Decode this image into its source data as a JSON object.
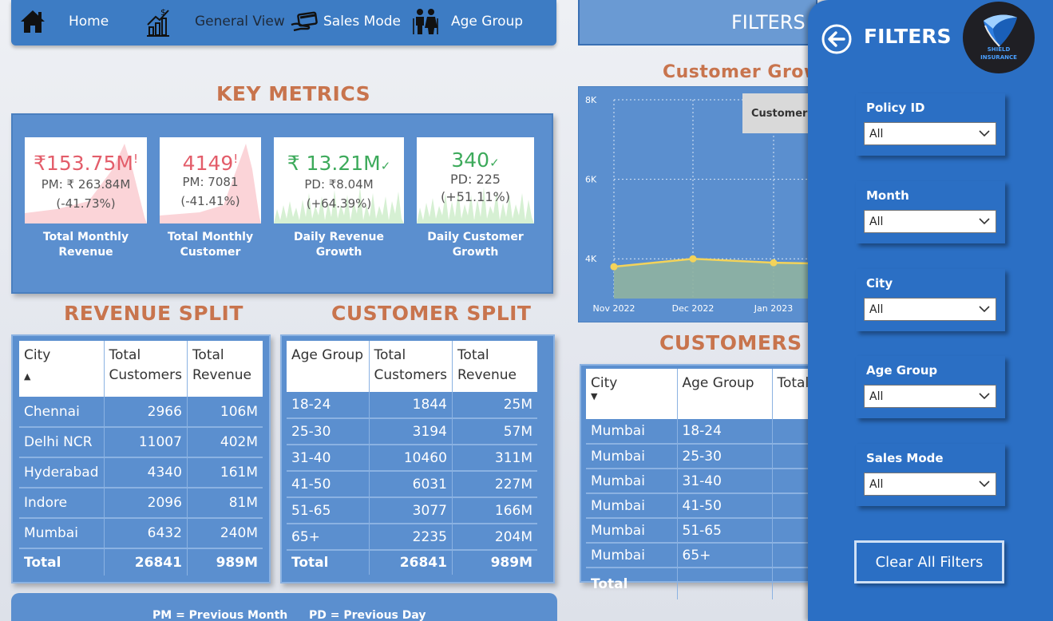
{
  "nav": {
    "home": "Home",
    "general_view": "General View",
    "sales_mode": "Sales Mode",
    "age_group": "Age Group",
    "filters_tab": "FILTERS"
  },
  "key_metrics": {
    "title": "KEY METRICS",
    "cards": [
      {
        "value": "₹153.75M",
        "flag": "!",
        "sub": "PM: ₹ 263.84M",
        "pct": "(-41.73%)",
        "caption_line1": "Total Monthly",
        "caption_line2": "Revenue",
        "status": "down"
      },
      {
        "value": "4149",
        "flag": "!",
        "sub": "PM: 7081",
        "pct": "(-41.41%)",
        "caption_line1": "Total Monthly",
        "caption_line2": "Customer",
        "status": "down"
      },
      {
        "value": "₹ 13.21M",
        "flag": "✓",
        "sub": "PD: ₹8.04M",
        "pct": "(+64.39%)",
        "caption_line1": "Daily Revenue",
        "caption_line2": "Growth",
        "status": "up"
      },
      {
        "value": "340",
        "flag": "✓",
        "sub": "PD: 225",
        "pct": "(+51.11%)",
        "caption_line1": "Daily Customer",
        "caption_line2": "Growth",
        "status": "up"
      }
    ]
  },
  "revenue_split": {
    "title": "REVENUE SPLIT",
    "headers": [
      "City",
      "Total Customers",
      "Total Revenue"
    ],
    "rows": [
      [
        "Chennai",
        "2966",
        "106M"
      ],
      [
        "Delhi NCR",
        "11007",
        "402M"
      ],
      [
        "Hyderabad",
        "4340",
        "161M"
      ],
      [
        "Indore",
        "2096",
        "81M"
      ],
      [
        "Mumbai",
        "6432",
        "240M"
      ]
    ],
    "total": [
      "Total",
      "26841",
      "989M"
    ]
  },
  "customer_split": {
    "title": "CUSTOMER SPLIT",
    "headers": [
      "Age Group",
      "Total Customers",
      "Total Revenue"
    ],
    "rows": [
      [
        "18-24",
        "1844",
        "25M"
      ],
      [
        "25-30",
        "3194",
        "57M"
      ],
      [
        "31-40",
        "10460",
        "311M"
      ],
      [
        "41-50",
        "6031",
        "227M"
      ],
      [
        "51-65",
        "3077",
        "166M"
      ],
      [
        "65+",
        "2235",
        "204M"
      ]
    ],
    "total": [
      "Total",
      "26841",
      "989M"
    ]
  },
  "customer_growth": {
    "title": "Customer Growth",
    "tooltip": "Customer",
    "chart_data": {
      "type": "area",
      "x": [
        "Nov 2022",
        "Dec 2022",
        "Jan 2023"
      ],
      "series": [
        {
          "values": [
            3800,
            4000,
            3900
          ]
        }
      ],
      "y_ticks": [
        "8K",
        "6K",
        "4K"
      ],
      "ylim": [
        3000,
        8000
      ],
      "grid": true,
      "line_color": "#f3d35a",
      "fill_color": "#8fb2a0"
    }
  },
  "customers_split": {
    "title": "CUSTOMERS SPLIT",
    "headers": [
      "City",
      "Age Group",
      "Total"
    ],
    "rows": [
      [
        "Mumbai",
        "18-24"
      ],
      [
        "Mumbai",
        "25-30"
      ],
      [
        "Mumbai",
        "31-40"
      ],
      [
        "Mumbai",
        "41-50"
      ],
      [
        "Mumbai",
        "51-65"
      ],
      [
        "Mumbai",
        "65+"
      ]
    ],
    "total": "Total"
  },
  "filter_pane": {
    "title": "FILTERS",
    "logo_line1": "SHIELD",
    "logo_line2": "INSURANCE",
    "slicers": [
      {
        "label": "Policy ID",
        "value": "All"
      },
      {
        "label": "Month",
        "value": "All"
      },
      {
        "label": "City",
        "value": "All"
      },
      {
        "label": "Age Group",
        "value": "All"
      },
      {
        "label": "Sales Mode",
        "value": "All"
      }
    ],
    "clear_button": "Clear All Filters"
  },
  "legend": {
    "pm": "PM = Previous Month",
    "pd": "PD = Previous Day"
  }
}
